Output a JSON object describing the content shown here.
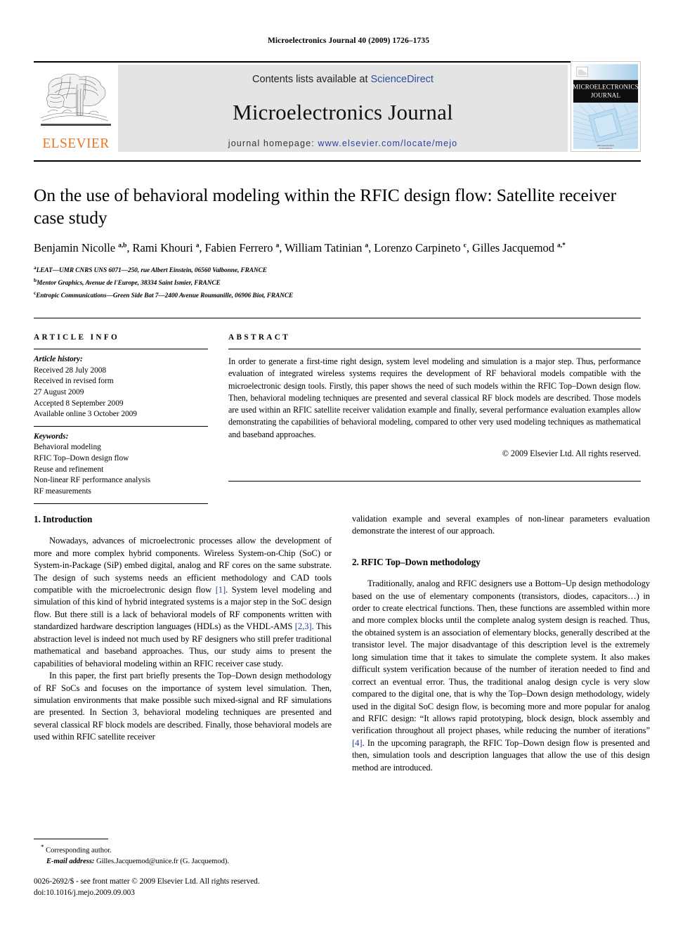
{
  "running_head": "Microelectronics Journal 40 (2009) 1726–1735",
  "masthead": {
    "contents_prefix": "Contents lists available at ",
    "sciencedirect": "ScienceDirect",
    "journal_name": "Microelectronics Journal",
    "homepage_prefix": "journal homepage: ",
    "homepage_url": "www.elsevier.com/locate/mejo",
    "publisher": "ELSEVIER",
    "cover_title_line1": "MICROELECTRONICS",
    "cover_title_line2": "JOURNAL",
    "link_color": "#2b4f9e",
    "publisher_color": "#E87722",
    "band_color": "#e4e4e4"
  },
  "article": {
    "title": "On the use of behavioral modeling within the RFIC design flow: Satellite receiver case study",
    "authors_html": "Benjamin Nicolle <sup>a,b</sup>, Rami Khouri <sup>a</sup>, Fabien Ferrero <sup>a</sup>, William Tatinian <sup>a</sup>, Lorenzo Carpineto <sup>c</sup>, Gilles Jacquemod <sup>a,*</sup>",
    "affiliations": [
      {
        "marker": "a",
        "text": "LEAT—UMR CNRS UNS 6071—250, rue Albert Einstein, 06560 Valbonne, FRANCE"
      },
      {
        "marker": "b",
        "text": "Mentor Graphics, Avenue de l'Europe, 38334 Saint Ismier, FRANCE"
      },
      {
        "marker": "c",
        "text": "Entropic Communications—Green Side Bat 7—2400 Avenue Roumanille, 06906 Biot, FRANCE"
      }
    ]
  },
  "article_info": {
    "heading": "ARTICLE INFO",
    "history_label": "Article history:",
    "history": [
      "Received 28 July 2008",
      "Received in revised form",
      "27 August 2009",
      "Accepted 8 September 2009",
      "Available online 3 October 2009"
    ],
    "keywords_label": "Keywords:",
    "keywords": [
      "Behavioral modeling",
      "RFIC Top–Down design flow",
      "Reuse and refinement",
      "Non-linear RF performance analysis",
      "RF measurements"
    ]
  },
  "abstract": {
    "heading": "ABSTRACT",
    "text": "In order to generate a first-time right design, system level modeling and simulation is a major step. Thus, performance evaluation of integrated wireless systems requires the development of RF behavioral models compatible with the microelectronic design tools. Firstly, this paper shows the need of such models within the RFIC Top–Down design flow. Then, behavioral modeling techniques are presented and several classical RF block models are described. Those models are used within an RFIC satellite receiver validation example and finally, several performance evaluation examples allow demonstrating the capabilities of behavioral modeling, compared to other very used modeling techniques as mathematical and baseband approaches.",
    "copyright": "© 2009 Elsevier Ltd. All rights reserved."
  },
  "body": {
    "left": {
      "heading": "1. Introduction",
      "para1_a": "Nowadays, advances of microelectronic processes allow the development of more and more complex hybrid components. Wireless System-on-Chip (SoC) or System-in-Package (SiP) embed digital, analog and RF cores on the same substrate. The design of such systems needs an efficient methodology and CAD tools compatible with the microelectronic design flow ",
      "para1_ref1": "[1]",
      "para1_b": ". System level modeling and simulation of this kind of hybrid integrated systems is a major step in the SoC design flow. But there still is a lack of behavioral models of RF components written with standardized hardware description languages (HDLs) as the VHDL-AMS ",
      "para1_ref2": "[2,3]",
      "para1_c": ". This abstraction level is indeed not much used by RF designers who still prefer traditional mathematical and baseband approaches. Thus, our study aims to present the capabilities of behavioral modeling within an RFIC receiver case study.",
      "para2": "In this paper, the first part briefly presents the Top–Down design methodology of RF SoCs and focuses on the importance of system level simulation. Then, simulation environments that make possible such mixed-signal and RF simulations are presented. In Section 3, behavioral modeling techniques are presented and several classical RF block models are described. Finally, those behavioral models are used within RFIC satellite receiver"
    },
    "right": {
      "para_cont": "validation example and several examples of non-linear parameters evaluation demonstrate the interest of our approach.",
      "heading": "2. RFIC Top–Down methodology",
      "para1_a": "Traditionally, analog and RFIC designers use a Bottom–Up design methodology based on the use of elementary components (transistors, diodes, capacitors…) in order to create electrical functions. Then, these functions are assembled within more and more complex blocks until the complete analog system design is reached. Thus, the obtained system is an association of elementary blocks, generally described at the transistor level. The major disadvantage of this description level is the extremely long simulation time that it takes to simulate the complete system. It also makes difficult system verification because of the number of iteration needed to find and correct an eventual error. Thus, the traditional analog design cycle is very slow compared to the digital one, that is why the Top–Down design methodology, widely used in the digital SoC design flow, is becoming more and more popular for analog and RFIC design: “It allows rapid prototyping, block design, block assembly and verification throughout all project phases, while reducing the number of iterations” ",
      "para1_ref": "[4]",
      "para1_b": ". In the upcoming paragraph, the RFIC Top–Down design flow is presented and then, simulation tools and description languages that allow the use of this design method are introduced."
    }
  },
  "footnotes": {
    "corresponding": "Corresponding author.",
    "email_label": "E-mail address:",
    "email_value": "Gilles.Jacquemod@unice.fr (G. Jacquemod).",
    "frontmatter": "0026-2692/$ - see front matter © 2009 Elsevier Ltd. All rights reserved.",
    "doi": "doi:10.1016/j.mejo.2009.09.003"
  }
}
